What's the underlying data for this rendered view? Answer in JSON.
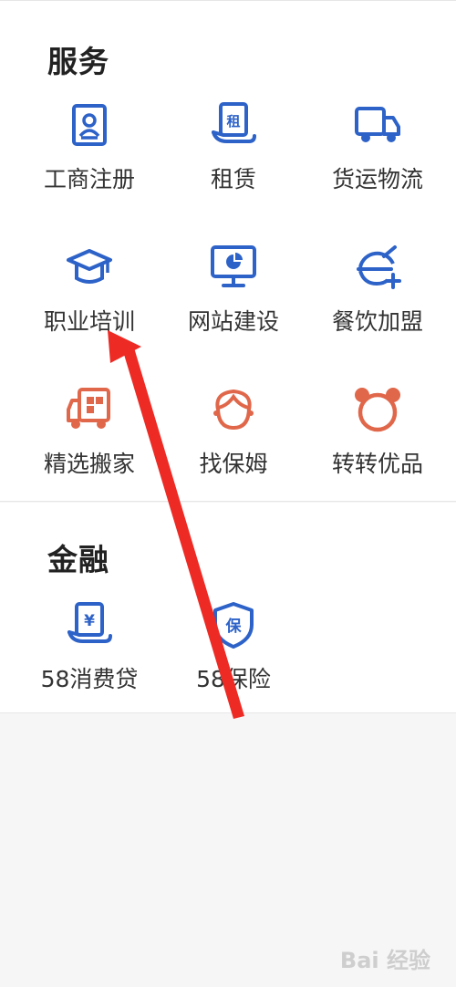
{
  "colors": {
    "blue": "#2d62c8",
    "orange": "#e0674a",
    "arrow": "#ee2a24"
  },
  "services": {
    "title": "服务",
    "items": [
      {
        "label": "工商注册",
        "icon": "id-card-icon"
      },
      {
        "label": "租赁",
        "icon": "rent-icon"
      },
      {
        "label": "货运物流",
        "icon": "truck-icon"
      },
      {
        "label": "职业培训",
        "icon": "graduation-cap-icon"
      },
      {
        "label": "网站建设",
        "icon": "monitor-chart-icon"
      },
      {
        "label": "餐饮加盟",
        "icon": "dining-bowl-icon"
      },
      {
        "label": "精选搬家",
        "icon": "moving-truck-icon"
      },
      {
        "label": "找保姆",
        "icon": "nanny-face-icon"
      },
      {
        "label": "转转优品",
        "icon": "bear-icon"
      }
    ],
    "rent_glyph": "租"
  },
  "finance": {
    "title": "金融",
    "items": [
      {
        "label": "58消费贷",
        "icon": "loan-icon"
      },
      {
        "label": "58保险",
        "icon": "insurance-shield-icon"
      }
    ],
    "loan_glyph": "¥",
    "insurance_glyph": "保"
  },
  "watermark": "Bai 经验"
}
